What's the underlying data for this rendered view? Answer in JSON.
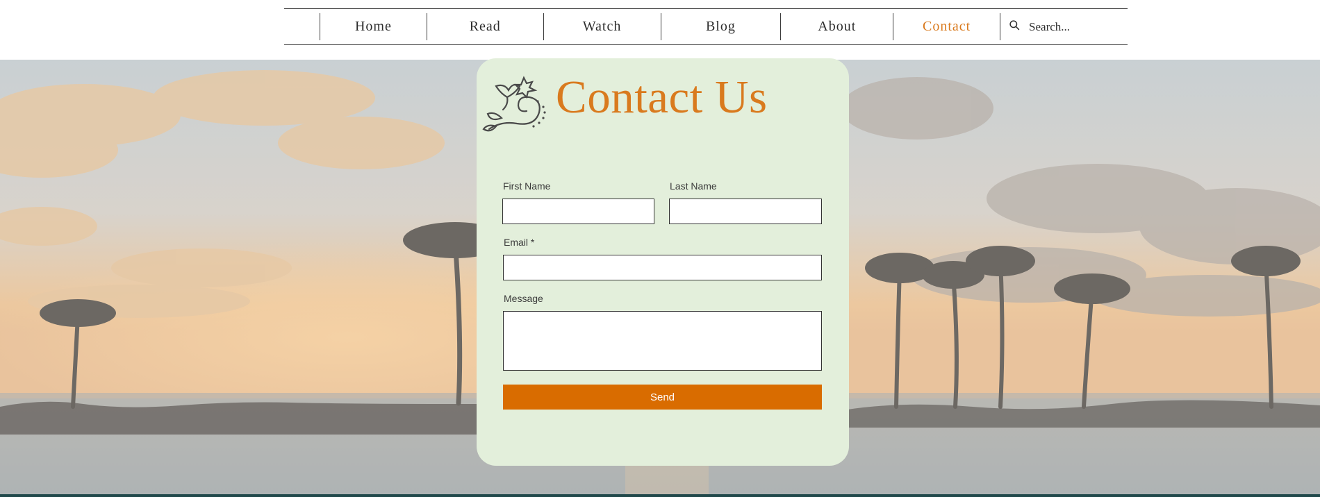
{
  "nav": {
    "items": [
      {
        "label": "Home"
      },
      {
        "label": "Read"
      },
      {
        "label": "Watch"
      },
      {
        "label": "Blog"
      },
      {
        "label": "About"
      },
      {
        "label": "Contact",
        "active": true
      }
    ],
    "search": {
      "placeholder": "Search...",
      "value": ""
    }
  },
  "icons": {
    "search": "search-icon",
    "flourish": "floral-flourish-icon"
  },
  "contact": {
    "title": "Contact Us",
    "first_name": {
      "label": "First Name",
      "value": ""
    },
    "last_name": {
      "label": "Last Name",
      "value": ""
    },
    "email": {
      "label": "Email *",
      "value": ""
    },
    "message": {
      "label": "Message",
      "value": ""
    },
    "send_label": "Send"
  },
  "colors": {
    "accent": "#d97a1e",
    "button": "#d96c00",
    "card_bg": "#e3efdb",
    "text": "#2d2d2d"
  }
}
